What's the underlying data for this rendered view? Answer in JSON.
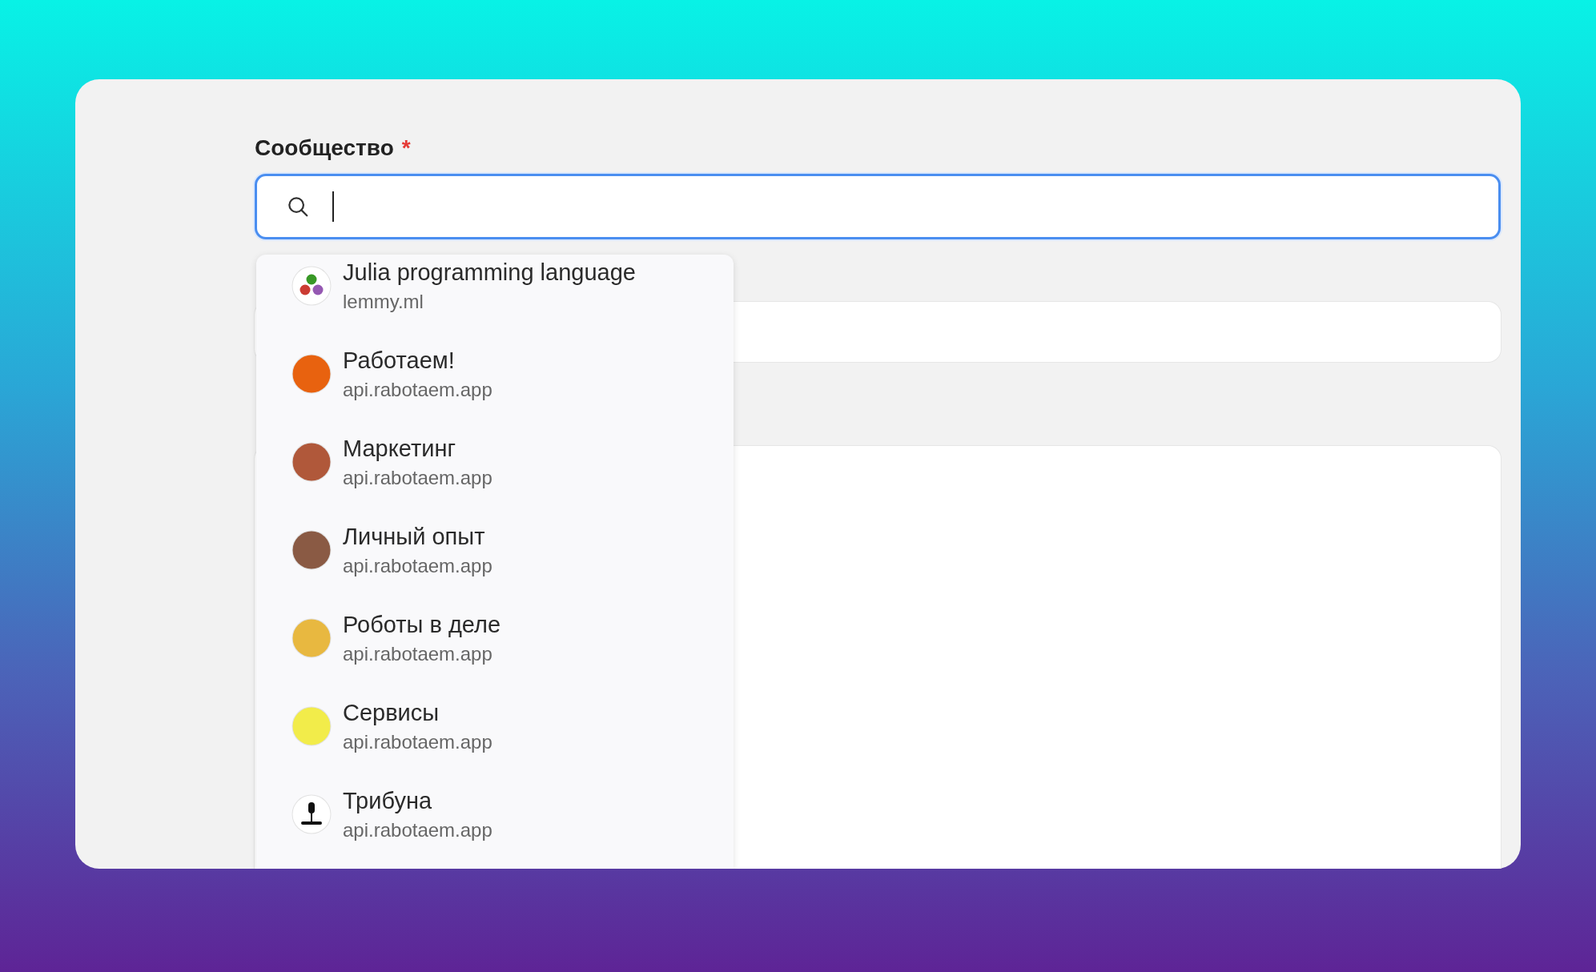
{
  "field": {
    "label": "Сообщество",
    "required_mark": "*",
    "focused": true
  },
  "suggestions": [
    {
      "title": "Julia programming language",
      "host": "lemmy.ml",
      "kind": "dots",
      "color": "#ffffff"
    },
    {
      "title": "Работаем!",
      "host": "api.rabotaem.app",
      "kind": "plain",
      "color": "#e8620f"
    },
    {
      "title": "Маркетинг",
      "host": "api.rabotaem.app",
      "kind": "plain",
      "color": "#b0583a"
    },
    {
      "title": "Личный опыт",
      "host": "api.rabotaem.app",
      "kind": "plain",
      "color": "#8a5a44"
    },
    {
      "title": "Роботы в деле",
      "host": "api.rabotaem.app",
      "kind": "plain",
      "color": "#e8b840"
    },
    {
      "title": "Сервисы",
      "host": "api.rabotaem.app",
      "kind": "plain",
      "color": "#f2ec4a"
    },
    {
      "title": "Трибуна",
      "host": "api.rabotaem.app",
      "kind": "mic",
      "color": "#ffffff"
    }
  ]
}
